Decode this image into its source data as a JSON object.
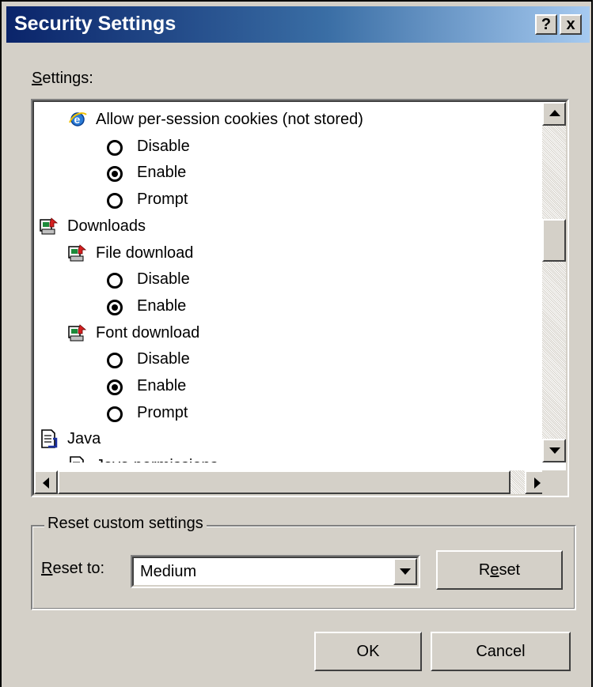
{
  "window": {
    "title": "Security Settings",
    "help_glyph": "?",
    "close_glyph": "x"
  },
  "settings": {
    "label": "Settings:",
    "items": [
      {
        "kind": "option",
        "icon": "ie-icon",
        "label": "Allow per-session cookies (not stored)"
      },
      {
        "kind": "radio",
        "label": "Disable",
        "checked": false
      },
      {
        "kind": "radio",
        "label": "Enable",
        "checked": true
      },
      {
        "kind": "radio",
        "label": "Prompt",
        "checked": false
      },
      {
        "kind": "category",
        "icon": "downloads-icon",
        "label": "Downloads"
      },
      {
        "kind": "option",
        "icon": "downloads-icon",
        "label": "File download"
      },
      {
        "kind": "radio",
        "label": "Disable",
        "checked": false
      },
      {
        "kind": "radio",
        "label": "Enable",
        "checked": true
      },
      {
        "kind": "option",
        "icon": "downloads-icon",
        "label": "Font download"
      },
      {
        "kind": "radio",
        "label": "Disable",
        "checked": false
      },
      {
        "kind": "radio",
        "label": "Enable",
        "checked": true
      },
      {
        "kind": "radio",
        "label": "Prompt",
        "checked": false
      },
      {
        "kind": "category",
        "icon": "document-icon",
        "label": "Java"
      },
      {
        "kind": "option",
        "icon": "document-icon",
        "label": "Java permissions"
      }
    ]
  },
  "reset": {
    "group_label": "Reset custom settings",
    "reset_to_label": "Reset to:",
    "selected_level": "Medium",
    "reset_button": "Reset"
  },
  "buttons": {
    "ok": "OK",
    "cancel": "Cancel"
  }
}
